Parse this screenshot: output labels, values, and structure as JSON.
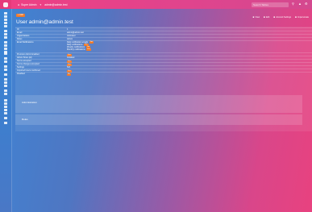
{
  "topbar": {
    "user_label": "Super Admin",
    "email": "admin@admin.test",
    "search_placeholder": "Search Tables",
    "colors": {
      "accent": "#e63a7a"
    }
  },
  "page": {
    "add_button": "+ Add",
    "title": "User admin@admin.test",
    "actions": [
      {
        "label": "View",
        "icon": "eye-icon"
      },
      {
        "label": "Edit",
        "icon": "pencil-icon"
      },
      {
        "label": "Account Settings",
        "icon": "gear-icon"
      },
      {
        "label": "Impersonate",
        "icon": "user-icon"
      }
    ]
  },
  "details": [
    {
      "label": "ID",
      "value": "1"
    },
    {
      "label": "Email",
      "value": "admin@admin.test"
    },
    {
      "label": "Organizations",
      "value": "Unlimited"
    },
    {
      "label": "Roles",
      "value": "Admin"
    },
    {
      "label": "Email Notifications",
      "notifications": [
        {
          "label": "Daily notification emails",
          "badge": "Yes"
        },
        {
          "label": "Daily notifications",
          "badge": "Yes"
        },
        {
          "label": "Weekly notifications",
          "badge": "Yes"
        },
        {
          "label": "Monthly notifications",
          "badge": "Yes"
        }
      ]
    },
    {
      "label": "Premium Admin Enabled",
      "badge": "Yes"
    },
    {
      "label": "Admin Since (at)",
      "value": "Installed"
    },
    {
      "label": "Terms accepted",
      "badge": "Yes"
    },
    {
      "label": "Terms changes accepted",
      "badge": "Yes"
    },
    {
      "label": "Settings",
      "value": "N/A"
    },
    {
      "label": "Imported Users confirmed",
      "badge": "Yes"
    },
    {
      "label": "Disabled",
      "badge": "No"
    }
  ],
  "panels": [
    {
      "title": "Administration"
    },
    {
      "title": "Roles"
    }
  ]
}
